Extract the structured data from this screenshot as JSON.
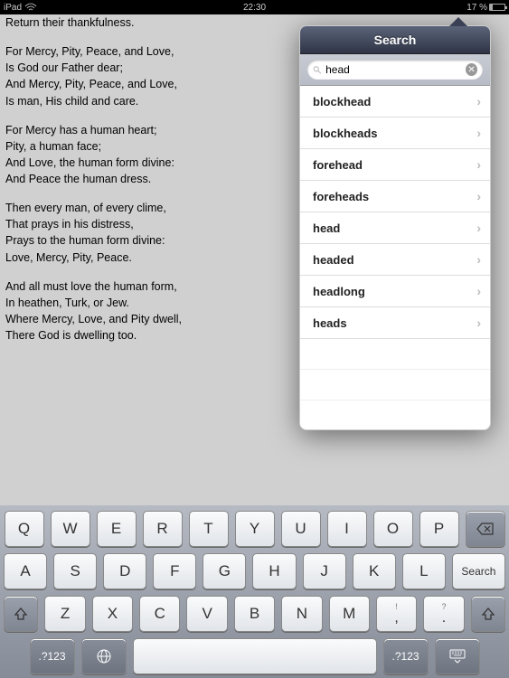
{
  "status": {
    "device": "iPad",
    "time": "22:30",
    "battery": "17 %"
  },
  "poem": {
    "line0": "Return their thankfulness.",
    "stanza1_l1": "For Mercy, Pity, Peace, and Love,",
    "stanza1_l2": " Is God our Father dear;",
    "stanza1_l3": "And Mercy, Pity, Peace, and Love,",
    "stanza1_l4": " Is man, His child and care.",
    "stanza2_l1": "For Mercy has a human heart;",
    "stanza2_l2": " Pity, a human face;",
    "stanza2_l3": "And Love, the human form divine:",
    "stanza2_l4": " And Peace the human dress.",
    "stanza3_l1": "Then every man, of every clime,",
    "stanza3_l2": " That prays in his distress,",
    "stanza3_l3": "Prays to the human form divine:",
    "stanza3_l4": " Love, Mercy, Pity, Peace.",
    "stanza4_l1": "And all must love the human form,",
    "stanza4_l2": " In heathen, Turk, or Jew.",
    "stanza4_l3": "Where Mercy, Love, and Pity dwell,",
    "stanza4_l4": " There God is dwelling too."
  },
  "search": {
    "title": "Search",
    "value": "head",
    "results": [
      "blockhead",
      "blockheads",
      "forehead",
      "foreheads",
      "head",
      "headed",
      "headlong",
      "heads"
    ]
  },
  "keyboard": {
    "row1": [
      "Q",
      "W",
      "E",
      "R",
      "T",
      "Y",
      "U",
      "I",
      "O",
      "P"
    ],
    "row2": [
      "A",
      "S",
      "D",
      "F",
      "G",
      "H",
      "J",
      "K",
      "L"
    ],
    "row3": [
      "Z",
      "X",
      "C",
      "V",
      "B",
      "N",
      "M"
    ],
    "search_label": "Search",
    "numkey": ".?123"
  }
}
